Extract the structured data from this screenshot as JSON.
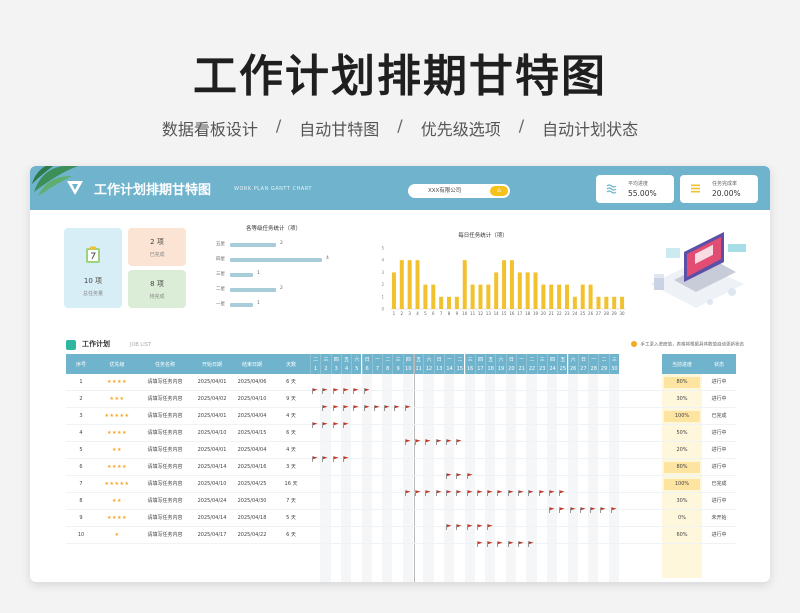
{
  "hero": {
    "title": "工作计划排期甘特图",
    "subtitles": [
      "数据看板设计",
      "自动甘特图",
      "优先级选项",
      "自动计划状态"
    ],
    "separator": "/"
  },
  "header": {
    "title": "工作计划排期甘特图",
    "subtitle_en": "WORK PLAN GANTT CHART",
    "company": "XXX有限公司",
    "kpis": [
      {
        "label": "平均进度",
        "value": "55.00%",
        "icon": "water-icon"
      },
      {
        "label": "任务完成率",
        "value": "20.00%",
        "icon": "list-icon"
      }
    ]
  },
  "summary": {
    "total": {
      "num": "10 项",
      "label": "总任务量"
    },
    "done": {
      "num": "2 项",
      "label": "已完成"
    },
    "todo": {
      "num": "8 项",
      "label": "待完成"
    }
  },
  "colors": {
    "accent": "#6fb3cc",
    "bar": "#f2c12e",
    "flag": "#c0392b",
    "star": "#f5a623"
  },
  "chart_data": [
    {
      "type": "bar",
      "title": "各等级任务统计（项）",
      "orientation": "horizontal",
      "categories": [
        "五星",
        "四星",
        "三星",
        "二星",
        "一星"
      ],
      "values": [
        2,
        4,
        1,
        2,
        1
      ],
      "xlim": [
        0,
        4
      ]
    },
    {
      "type": "bar",
      "title": "每日任务统计（项）",
      "categories": [
        "1",
        "2",
        "3",
        "4",
        "5",
        "6",
        "7",
        "8",
        "9",
        "10",
        "11",
        "12",
        "13",
        "14",
        "15",
        "16",
        "17",
        "18",
        "19",
        "20",
        "21",
        "22",
        "23",
        "24",
        "25",
        "26",
        "27",
        "28",
        "29",
        "30"
      ],
      "values": [
        3,
        4,
        4,
        4,
        2,
        2,
        1,
        1,
        1,
        4,
        2,
        2,
        2,
        3,
        4,
        4,
        3,
        3,
        3,
        2,
        2,
        2,
        2,
        1,
        2,
        2,
        1,
        1,
        1,
        1
      ],
      "ylim": [
        0,
        5
      ],
      "yticks": [
        "0",
        "1",
        "2",
        "3",
        "4",
        "5"
      ]
    }
  ],
  "plan": {
    "title": "工作计划",
    "title_en": "JOB LIST",
    "note": "手工录入进度值，表格将根据具体数值自动更新状态",
    "columns": {
      "no": "序号",
      "priority": "优先级",
      "name": "任务名称",
      "start": "开始日期",
      "end": "结束日期",
      "days": "天数",
      "progress": "当前进度",
      "status": "状态"
    },
    "weekdays": [
      "二",
      "三",
      "四",
      "五",
      "六",
      "日",
      "一",
      "二",
      "三",
      "四",
      "五",
      "六",
      "日",
      "一",
      "二",
      "三",
      "四",
      "五",
      "六",
      "日",
      "一",
      "二",
      "三",
      "四",
      "五",
      "六",
      "日",
      "一",
      "二",
      "三"
    ],
    "days": [
      "1",
      "2",
      "3",
      "4",
      "5",
      "6",
      "7",
      "8",
      "9",
      "10",
      "11",
      "12",
      "13",
      "14",
      "15",
      "16",
      "17",
      "18",
      "19",
      "20",
      "21",
      "22",
      "23",
      "24",
      "25",
      "26",
      "27",
      "28",
      "29",
      "30"
    ],
    "rows": [
      {
        "no": "1",
        "stars": "★★★★",
        "name": "请填写任务内容",
        "start": "2025/04/01",
        "end": "2025/04/06",
        "days": "6 天",
        "progress": "80%",
        "status": "进行中",
        "s": 1,
        "e": 6
      },
      {
        "no": "2",
        "stars": "★★★",
        "name": "请填写任务内容",
        "start": "2025/04/02",
        "end": "2025/04/10",
        "days": "9 天",
        "progress": "30%",
        "status": "进行中",
        "s": 2,
        "e": 10
      },
      {
        "no": "3",
        "stars": "★★★★★",
        "name": "请填写任务内容",
        "start": "2025/04/01",
        "end": "2025/04/04",
        "days": "4 天",
        "progress": "100%",
        "status": "已完成",
        "s": 1,
        "e": 4
      },
      {
        "no": "4",
        "stars": "★★★★",
        "name": "请填写任务内容",
        "start": "2025/04/10",
        "end": "2025/04/15",
        "days": "6 天",
        "progress": "50%",
        "status": "进行中",
        "s": 10,
        "e": 15
      },
      {
        "no": "5",
        "stars": "★★",
        "name": "请填写任务内容",
        "start": "2025/04/01",
        "end": "2025/04/04",
        "days": "4 天",
        "progress": "20%",
        "status": "进行中",
        "s": 1,
        "e": 4
      },
      {
        "no": "6",
        "stars": "★★★★",
        "name": "请填写任务内容",
        "start": "2025/04/14",
        "end": "2025/04/16",
        "days": "3 天",
        "progress": "80%",
        "status": "进行中",
        "s": 14,
        "e": 16
      },
      {
        "no": "7",
        "stars": "★★★★★",
        "name": "请填写任务内容",
        "start": "2025/04/10",
        "end": "2025/04/25",
        "days": "16 天",
        "progress": "100%",
        "status": "已完成",
        "s": 10,
        "e": 25
      },
      {
        "no": "8",
        "stars": "★★",
        "name": "请填写任务内容",
        "start": "2025/04/24",
        "end": "2025/04/30",
        "days": "7 天",
        "progress": "30%",
        "status": "进行中",
        "s": 24,
        "e": 30
      },
      {
        "no": "9",
        "stars": "★★★★",
        "name": "请填写任务内容",
        "start": "2025/04/14",
        "end": "2025/04/18",
        "days": "5 天",
        "progress": "0%",
        "status": "未开始",
        "s": 14,
        "e": 18
      },
      {
        "no": "10",
        "stars": "★",
        "name": "请填写任务内容",
        "start": "2025/04/17",
        "end": "2025/04/22",
        "days": "6 天",
        "progress": "60%",
        "status": "进行中",
        "s": 17,
        "e": 22
      }
    ]
  }
}
